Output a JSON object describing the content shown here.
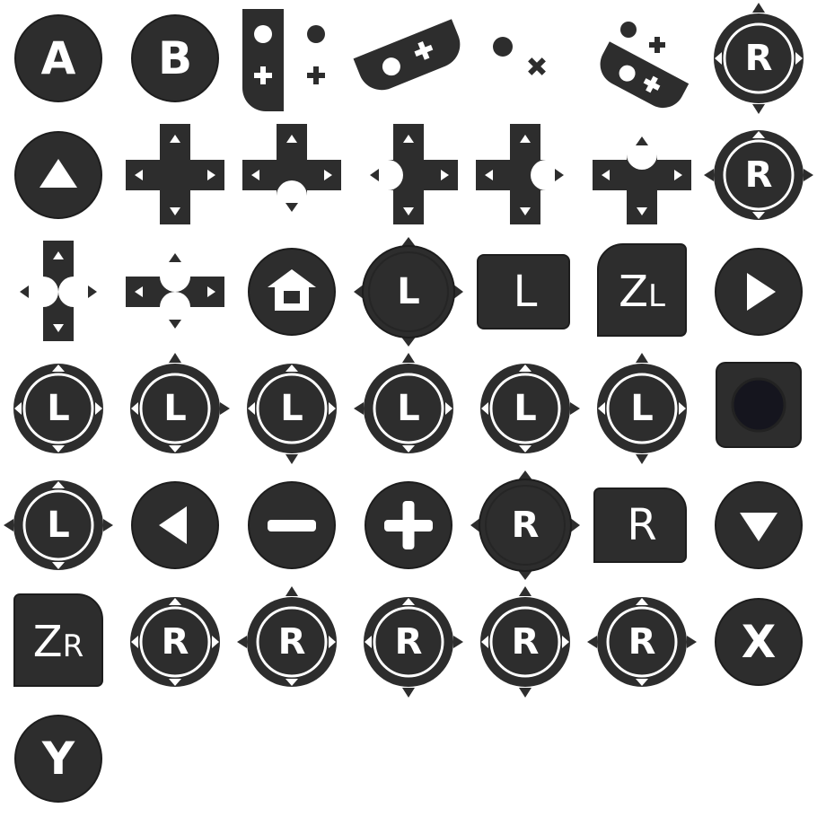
{
  "palette": {
    "dark": "#2d2d2d",
    "stroke": "#1d1d1d",
    "light": "#ffffff",
    "well": "#15151e"
  },
  "labels": {
    "a": "A",
    "b": "B",
    "x": "X",
    "y": "Y",
    "l": "L",
    "r": "R",
    "zl_z": "Z",
    "zl_l": "L",
    "zr_z": "Z",
    "zr_r": "R"
  },
  "icons": [
    "button-a-icon",
    "button-b-icon",
    "joycon-left-sideways-icon",
    "joycon-tilted-icon",
    "buttons-dot-plus-icon",
    "joycon-tilted-dots-icon",
    "stick-r-icon",
    "button-up-arrow-icon",
    "dpad-icon",
    "dpad-down-icon",
    "dpad-left-icon",
    "dpad-right-icon",
    "dpad-up-icon",
    "stick-r-left-icon",
    "dpad-vertical-icon",
    "dpad-horizontal-icon",
    "home-button-icon",
    "stick-l-press-icon",
    "button-l-icon",
    "button-zl-icon",
    "button-play-icon",
    "stick-l-icons",
    "square-stick-icon",
    "stick-l-all-icon",
    "button-left-arrow-icon",
    "button-minus-icon",
    "button-plus-icon",
    "stick-r-press-icon",
    "button-r-icon",
    "button-down-arrow-icon",
    "button-zr-icon",
    "stick-r-icons",
    "button-x-icon",
    "button-y-icon"
  ]
}
